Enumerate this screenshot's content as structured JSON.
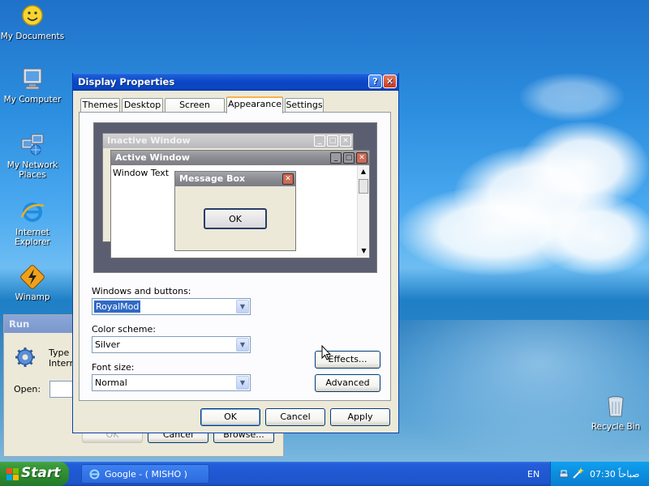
{
  "desktop": {
    "icons": [
      {
        "label": "My Documents",
        "icon": "smiley-face-icon"
      },
      {
        "label": "My Computer",
        "icon": "computer-monitor-icon"
      },
      {
        "label": "My Network Places",
        "icon": "network-computers-icon"
      },
      {
        "label": "Internet Explorer",
        "icon": "internet-explorer-icon"
      },
      {
        "label": "Winamp",
        "icon": "winamp-bolt-icon"
      },
      {
        "label": "Recycle Bin",
        "icon": "recycle-bin-icon"
      }
    ]
  },
  "run_dialog": {
    "title": "Run",
    "prompt_partial": "Type t",
    "prompt_partial_2": "Intern",
    "open_label": "Open:",
    "ok_label": "OK",
    "cancel_label": "Cancel",
    "browse_label": "Browse..."
  },
  "display_properties": {
    "title": "Display Properties",
    "tabs": [
      {
        "label": "Themes",
        "active": false
      },
      {
        "label": "Desktop",
        "active": false
      },
      {
        "label": "Screen Saver",
        "active": false
      },
      {
        "label": "Appearance",
        "active": true
      },
      {
        "label": "Settings",
        "active": false
      }
    ],
    "preview": {
      "inactive_title": "Inactive Window",
      "active_title": "Active Window",
      "window_text": "Window Text",
      "message_box_title": "Message Box",
      "ok_label": "OK"
    },
    "windows_and_buttons": {
      "label": "Windows and buttons:",
      "value": "RoyalMod"
    },
    "color_scheme": {
      "label": "Color scheme:",
      "value": "Silver"
    },
    "font_size": {
      "label": "Font size:",
      "value": "Normal"
    },
    "effects_label": "Effects...",
    "advanced_label": "Advanced",
    "ok_label": "OK",
    "cancel_label": "Cancel",
    "apply_label": "Apply"
  },
  "taskbar": {
    "start_label": "Start",
    "task_label": "Google - ( MISHO )",
    "language": "EN",
    "clock": "07:30 صباحاً"
  },
  "colors": {
    "xp_blue": "#0a46c6",
    "start_green": "#2d8a2d",
    "tray_blue": "#0c8ee0",
    "selection": "#316ac5"
  }
}
